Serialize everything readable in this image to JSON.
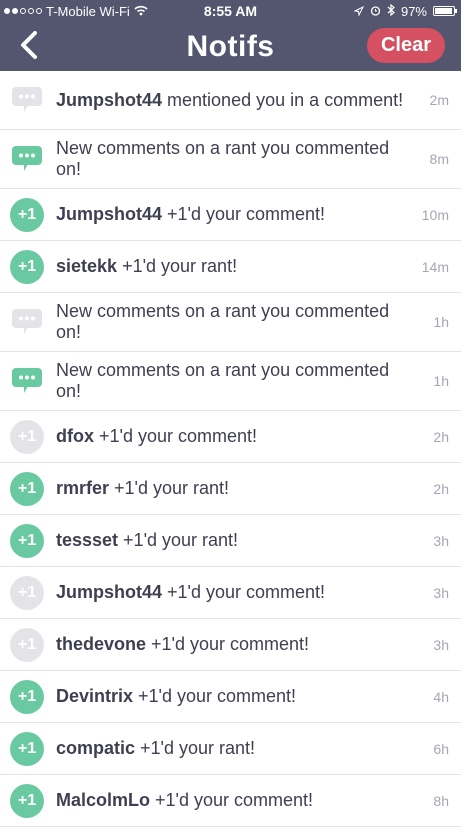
{
  "status": {
    "carrier": "T-Mobile Wi-Fi",
    "time": "8:55 AM",
    "battery": "97%"
  },
  "nav": {
    "title": "Notifs",
    "clear_label": "Clear"
  },
  "colors": {
    "header_bg": "#54556e",
    "clear_bg": "#d55161",
    "unread_green": "#69c9a1",
    "read_gray": "#e4e4e8"
  },
  "notifications": [
    {
      "icon": "comment-icon",
      "unread": false,
      "user": "Jumpshot44",
      "text": " mentioned you in a comment!",
      "time": "2m"
    },
    {
      "icon": "comment-icon",
      "unread": true,
      "user": "",
      "text": "New comments on a rant you commented on!",
      "time": "8m"
    },
    {
      "icon": "plus-one-icon",
      "unread": true,
      "user": "Jumpshot44",
      "text": " +1'd your comment!",
      "time": "10m"
    },
    {
      "icon": "plus-one-icon",
      "unread": true,
      "user": "sietekk",
      "text": " +1'd your rant!",
      "time": "14m"
    },
    {
      "icon": "comment-icon",
      "unread": false,
      "user": "",
      "text": "New comments on a rant you commented on!",
      "time": "1h"
    },
    {
      "icon": "comment-icon",
      "unread": true,
      "user": "",
      "text": "New comments on a rant you commented on!",
      "time": "1h"
    },
    {
      "icon": "plus-one-icon",
      "unread": false,
      "user": "dfox",
      "text": " +1'd your comment!",
      "time": "2h"
    },
    {
      "icon": "plus-one-icon",
      "unread": true,
      "user": "rmrfer",
      "text": " +1'd your rant!",
      "time": "2h"
    },
    {
      "icon": "plus-one-icon",
      "unread": true,
      "user": "tessset",
      "text": " +1'd your rant!",
      "time": "3h"
    },
    {
      "icon": "plus-one-icon",
      "unread": false,
      "user": "Jumpshot44",
      "text": " +1'd your comment!",
      "time": "3h"
    },
    {
      "icon": "plus-one-icon",
      "unread": false,
      "user": "thedevone",
      "text": " +1'd your comment!",
      "time": "3h"
    },
    {
      "icon": "plus-one-icon",
      "unread": true,
      "user": "Devintrix",
      "text": " +1'd your comment!",
      "time": "4h"
    },
    {
      "icon": "plus-one-icon",
      "unread": true,
      "user": "compatic",
      "text": " +1'd your rant!",
      "time": "6h"
    },
    {
      "icon": "plus-one-icon",
      "unread": true,
      "user": "MalcolmLo",
      "text": " +1'd your comment!",
      "time": "8h"
    }
  ],
  "plus_one_text": "+1"
}
